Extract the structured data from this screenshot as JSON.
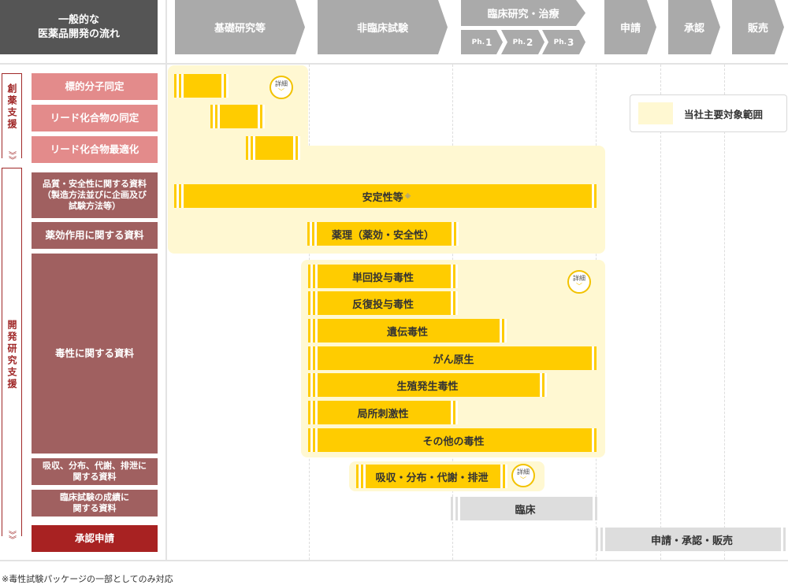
{
  "header": {
    "title": "一般的な\n医薬品開発の流れ",
    "stages": {
      "basic": "基礎研究等",
      "nonclinical": "非臨床試験",
      "clinical": "臨床研究・治療",
      "application": "申請",
      "approval": "承認",
      "sales": "販売"
    },
    "phases": [
      {
        "prefix": "Ph.",
        "num": "1"
      },
      {
        "prefix": "Ph.",
        "num": "2"
      },
      {
        "prefix": "Ph.",
        "num": "3"
      }
    ]
  },
  "side": {
    "discovery": "創薬支援",
    "development": "開発研究支援"
  },
  "rows": {
    "r1": "標的分子同定",
    "r2": "リード化合物の同定",
    "r3": "リード化合物最適化",
    "r4": "品質・安全性に関する資料\n（製造方法並びに企画及び\n試験方法等）",
    "r5": "薬効作用に関する資料",
    "r6": "毒性に関する資料",
    "r7": "吸収、分布、代謝、排泄に\n関する資料",
    "r8": "臨床試験の成績に\n関する資料",
    "r9": "承認申請"
  },
  "bars": {
    "stability": "安定性等",
    "stability_note": "※",
    "pharmacology": "薬理（薬効・安全性）",
    "single_dose": "単回投与毒性",
    "repeat_dose": "反復投与毒性",
    "genotox": "遺伝毒性",
    "carcino": "がん原生",
    "repro": "生殖発生毒性",
    "local": "局所刺激性",
    "other_tox": "その他の毒性",
    "adme": "吸収・分布・代謝・排泄",
    "clinical": "臨床",
    "approval": "申請・承認・販売"
  },
  "detail_label": "詳細",
  "legend": "当社主要対象範囲",
  "footnote": "※毒性試験パッケージの一部としてのみ対応",
  "colors": {
    "accent_yellow": "#ffcc00",
    "zone_yellow": "#fff8d2",
    "header_gray": "#aaaaaa",
    "label_pink": "#e38b8b",
    "label_mid": "#a06060",
    "label_red": "#a82222"
  }
}
